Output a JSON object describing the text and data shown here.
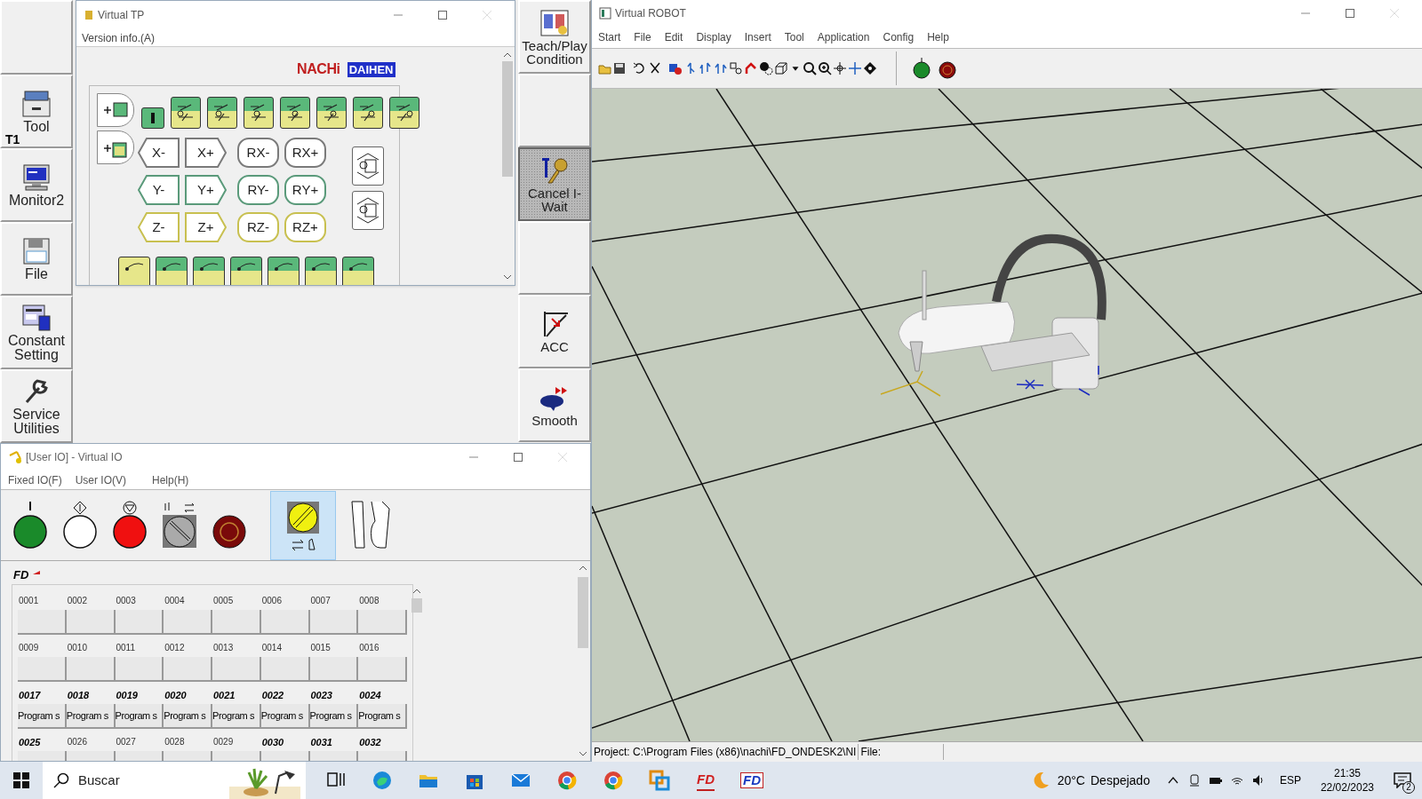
{
  "left_buttons": [
    {
      "label": "Tool",
      "badge": "T1"
    },
    {
      "label": "Monitor2"
    },
    {
      "label": "File"
    },
    {
      "label": "Constant Setting"
    },
    {
      "label": "Service Utilities"
    }
  ],
  "right_buttons": [
    {
      "label": "Teach/Play Condition",
      "active": false
    },
    {
      "label": "Cancel I-Wait",
      "active": true
    },
    {
      "label": "ACC",
      "active": false
    },
    {
      "label": "Smooth",
      "active": false
    }
  ],
  "tp_window": {
    "title": "Virtual TP",
    "menu": [
      "Version info.(A)"
    ],
    "logos": [
      "NACHi",
      "DAIHEN"
    ],
    "jog_rows": [
      [
        {
          "label": "X-",
          "kind": "left"
        },
        {
          "label": "X+",
          "kind": "right"
        },
        {
          "label": "RX-",
          "kind": "round"
        },
        {
          "label": "RX+",
          "kind": "round"
        }
      ],
      [
        {
          "label": "Y-",
          "kind": "left"
        },
        {
          "label": "Y+",
          "kind": "right"
        },
        {
          "label": "RY-",
          "kind": "round"
        },
        {
          "label": "RY+",
          "kind": "round"
        }
      ],
      [
        {
          "label": "Z-",
          "kind": "left"
        },
        {
          "label": "Z+",
          "kind": "right"
        },
        {
          "label": "RZ-",
          "kind": "round"
        },
        {
          "label": "RZ+",
          "kind": "round"
        }
      ]
    ]
  },
  "robot_window": {
    "title": "Virtual ROBOT",
    "menu": [
      "Start",
      "File",
      "Edit",
      "Display",
      "Insert",
      "Tool",
      "Application",
      "Config",
      "Help"
    ],
    "status_bar": {
      "project": "Project: C:\\Program Files (x86)\\nachi\\FD_ONDESK2\\NI",
      "file": "File:"
    }
  },
  "io_window": {
    "title": "[User IO] - Virtual IO",
    "menu": [
      "Fixed IO(F)",
      "User IO(V)",
      "Help(H)"
    ],
    "toolbar": [
      {
        "kind": "start",
        "selected": false
      },
      {
        "kind": "hold",
        "selected": false
      },
      {
        "kind": "stop",
        "selected": false
      },
      {
        "kind": "selector",
        "selected": false
      },
      {
        "kind": "emergency",
        "selected": false
      },
      {
        "kind": "mode",
        "selected": true
      },
      {
        "kind": "gripper",
        "selected": false
      }
    ],
    "logo": "FD",
    "cells": [
      {
        "label": "0001",
        "bold": false
      },
      {
        "label": "0002",
        "bold": false
      },
      {
        "label": "0003",
        "bold": false
      },
      {
        "label": "0004",
        "bold": false
      },
      {
        "label": "0005",
        "bold": false
      },
      {
        "label": "0006",
        "bold": false
      },
      {
        "label": "0007",
        "bold": false
      },
      {
        "label": "0008",
        "bold": false
      },
      {
        "label": "0009",
        "bold": false
      },
      {
        "label": "0010",
        "bold": false
      },
      {
        "label": "0011",
        "bold": false
      },
      {
        "label": "0012",
        "bold": false
      },
      {
        "label": "0013",
        "bold": false
      },
      {
        "label": "0014",
        "bold": false
      },
      {
        "label": "0015",
        "bold": false
      },
      {
        "label": "0016",
        "bold": false
      },
      {
        "label": "0017",
        "bold": true,
        "value": "Program s"
      },
      {
        "label": "0018",
        "bold": true,
        "value": "Program s"
      },
      {
        "label": "0019",
        "bold": true,
        "value": "Program s"
      },
      {
        "label": "0020",
        "bold": true,
        "value": "Program s"
      },
      {
        "label": "0021",
        "bold": true,
        "value": "Program s"
      },
      {
        "label": "0022",
        "bold": true,
        "value": "Program s"
      },
      {
        "label": "0023",
        "bold": true,
        "value": "Program s"
      },
      {
        "label": "0024",
        "bold": true,
        "value": "Program s"
      },
      {
        "label": "0025",
        "bold": true
      },
      {
        "label": "0026",
        "bold": false
      },
      {
        "label": "0027",
        "bold": false
      },
      {
        "label": "0028",
        "bold": false
      },
      {
        "label": "0029",
        "bold": false
      },
      {
        "label": "0030",
        "bold": true
      },
      {
        "label": "0031",
        "bold": true
      },
      {
        "label": "0032",
        "bold": true
      }
    ]
  },
  "taskbar": {
    "search": {
      "placeholder": "Buscar"
    },
    "apps": [
      {
        "kind": "taskview"
      },
      {
        "kind": "edge"
      },
      {
        "kind": "folder"
      },
      {
        "kind": "store"
      },
      {
        "kind": "mail"
      },
      {
        "kind": "chrome"
      },
      {
        "kind": "chrome"
      },
      {
        "kind": "remote"
      },
      {
        "kind": "fd",
        "label": "FD"
      },
      {
        "kind": "fd2",
        "label": "FD"
      }
    ],
    "weather": {
      "temperature": "20°C",
      "condition": "Despejado"
    },
    "language": "ESP",
    "time": "21:35",
    "date": "22/02/2023",
    "notifications": "2"
  }
}
